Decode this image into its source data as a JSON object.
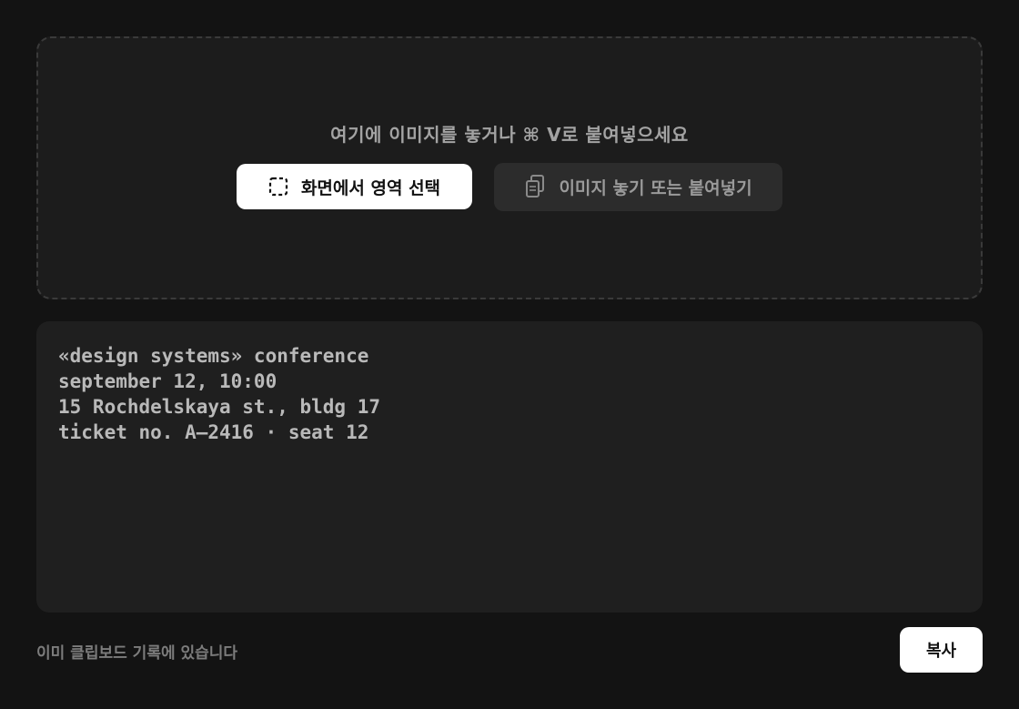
{
  "drop_zone": {
    "hint": "여기에 이미지를 놓거나 ⌘ V로 붙여넣으세요",
    "select_area_label": "화면에서 영역 선택",
    "drop_paste_label": "이미지 놓기 또는 붙여넣기"
  },
  "text_output": {
    "lines": [
      "«design systems» conference",
      "september 12, 10:00",
      "15 Rochdelskaya st., bldg 17",
      "ticket no. A–2416 · seat 12"
    ]
  },
  "footer": {
    "status": "이미 클립보드 기록에 있습니다",
    "copy_label": "복사"
  },
  "icons": {
    "select_area": "selection-frame-icon",
    "paste": "clipboard-copy-icon"
  },
  "colors": {
    "background": "#131313",
    "panel": "#1f1f1f",
    "primary_button": "#ffffff",
    "secondary_button": "#2c2c2c"
  }
}
